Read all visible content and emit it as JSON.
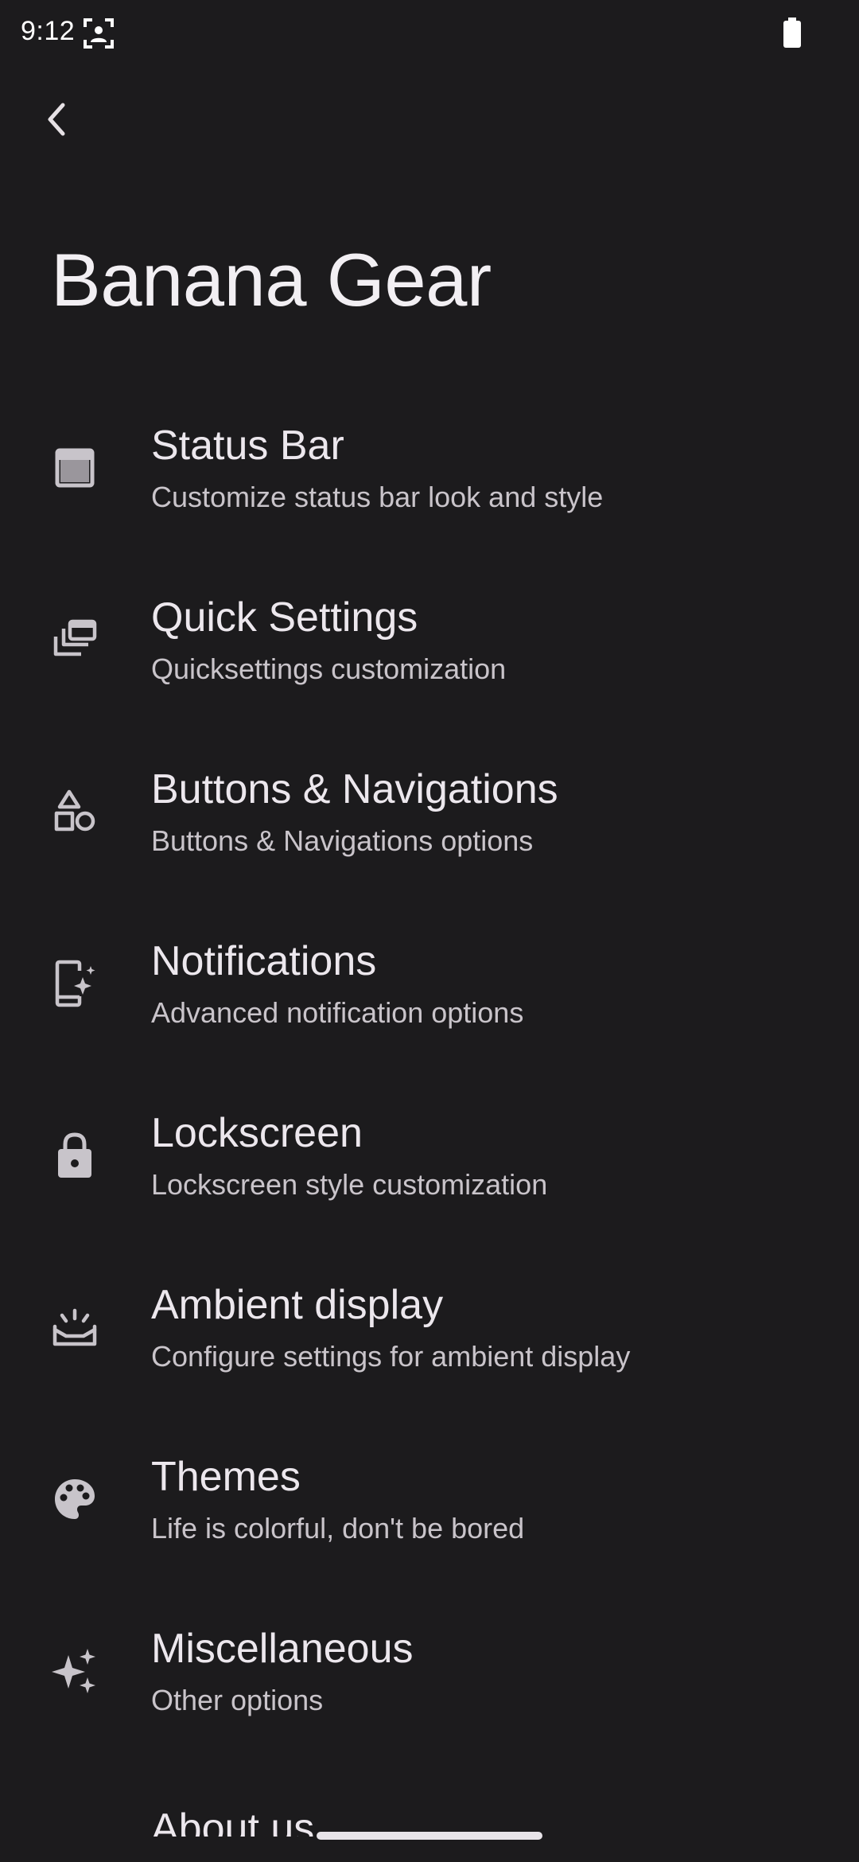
{
  "status_bar": {
    "time": "9:12"
  },
  "header": {
    "title": "Banana Gear"
  },
  "menu": {
    "items": [
      {
        "title": "Status Bar",
        "subtitle": "Customize status bar look and style",
        "icon": "status-bar-icon"
      },
      {
        "title": "Quick Settings",
        "subtitle": "Quicksettings customization",
        "icon": "quick-settings-icon"
      },
      {
        "title": "Buttons & Navigations",
        "subtitle": "Buttons & Navigations options",
        "icon": "shapes-icon"
      },
      {
        "title": "Notifications",
        "subtitle": "Advanced notification options",
        "icon": "notification-sparkle-icon"
      },
      {
        "title": "Lockscreen",
        "subtitle": "Lockscreen style customization",
        "icon": "lock-icon"
      },
      {
        "title": "Ambient display",
        "subtitle": "Configure settings for ambient display",
        "icon": "ambient-display-icon"
      },
      {
        "title": "Themes",
        "subtitle": "Life is colorful, don't be bored",
        "icon": "palette-icon"
      },
      {
        "title": "Miscellaneous",
        "subtitle": "Other options",
        "icon": "sparkles-icon"
      },
      {
        "title": "About us",
        "subtitle": "",
        "icon": ""
      }
    ]
  },
  "colors": {
    "background": "#1c1b1d",
    "text": "#ece7ed",
    "subtext": "#c9c4ca",
    "icon": "#c8c4ca"
  }
}
